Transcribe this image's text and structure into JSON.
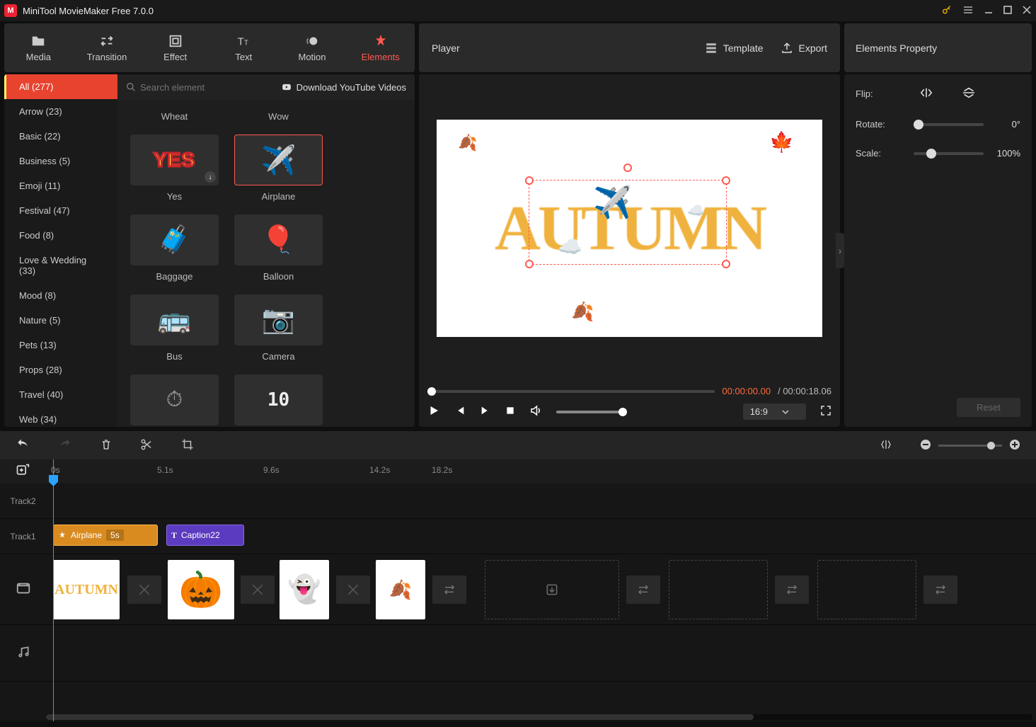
{
  "app": {
    "title": "MiniTool MovieMaker Free 7.0.0"
  },
  "toolbar": {
    "media": "Media",
    "transition": "Transition",
    "effect": "Effect",
    "text": "Text",
    "motion": "Motion",
    "elements": "Elements"
  },
  "player": {
    "title": "Player",
    "template": "Template",
    "export": "Export",
    "current_time": "00:00:00.00",
    "total_time": "00:00:18.06",
    "sep": " / ",
    "aspect": "16:9"
  },
  "props": {
    "title": "Elements Property",
    "flip": "Flip:",
    "rotate": "Rotate:",
    "rotate_val": "0°",
    "scale": "Scale:",
    "scale_val": "100%",
    "reset": "Reset"
  },
  "search": {
    "placeholder": "Search element"
  },
  "download_yt": "Download YouTube Videos",
  "categories": [
    "All (277)",
    "Arrow (23)",
    "Basic (22)",
    "Business (5)",
    "Emoji (11)",
    "Festival (47)",
    "Food (8)",
    "Love & Wedding (33)",
    "Mood (8)",
    "Nature (5)",
    "Pets (13)",
    "Props (28)",
    "Travel (40)",
    "Web (34)"
  ],
  "elements": {
    "row0": [
      "Wheat",
      "Wow"
    ],
    "row1": [
      "Yes",
      "Airplane"
    ],
    "row2": [
      "Baggage",
      "Balloon"
    ],
    "row3": [
      "Bus",
      "Camera"
    ]
  },
  "timeline": {
    "marks": [
      "0s",
      "5.1s",
      "9.6s",
      "14.2s",
      "18.2s"
    ],
    "track2": "Track2",
    "track1": "Track1",
    "clip_airplane": "Airplane",
    "clip_airplane_dur": "5s",
    "clip_caption": "Caption22"
  }
}
